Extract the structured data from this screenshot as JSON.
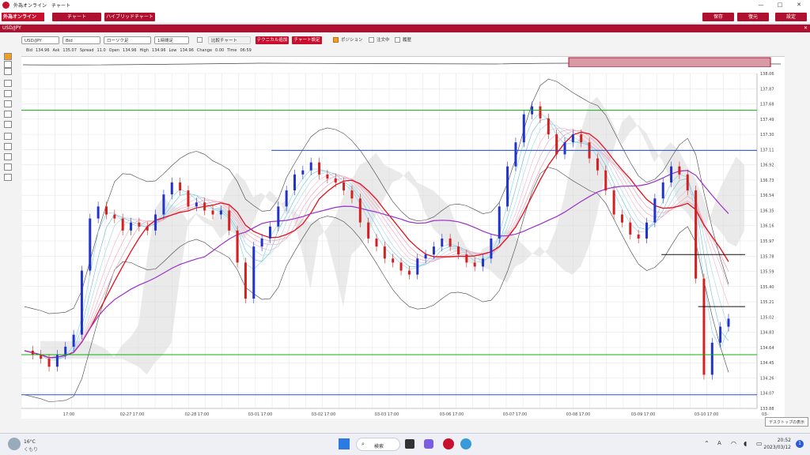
{
  "app": {
    "title": "外為オンライン　チャート"
  },
  "nav": {
    "brand": "外為オンライン",
    "chart": "チャート",
    "hybrid": "ハイブリッドチャート",
    "save": "保存",
    "restore": "復元",
    "settings": "設定"
  },
  "pair": "USD/JPY",
  "toolbar": {
    "symbol": "USD/JPY",
    "price_type": "Bid",
    "chart_type": "ローソク足",
    "timeframe": "1時間足",
    "compare": "比較チャート",
    "add_tech": "テクニカル追加",
    "chart_settings": "チャート設定",
    "position": "ポジション",
    "order": "注文中",
    "history": "履歴"
  },
  "info": [
    "Bid",
    "134.96",
    "Ask",
    "135.07",
    "Spread",
    "11.0",
    "Open",
    "134.96",
    "High",
    "134.96",
    "Low",
    "134.96",
    "Change",
    "0.00",
    "Time",
    "06:59"
  ],
  "taskbar": {
    "temp": "16°C",
    "weather": "くもり",
    "search": "検索",
    "time": "20:52",
    "date": "2023/03/12",
    "tooltip": "デスクトップの表示",
    "ime": "A",
    "notif": "1"
  },
  "colors": {
    "brand": "#c8102e",
    "bull": "#2233cc",
    "bear": "#d42020",
    "ma_red": "#e0101a",
    "ma_purple": "#9b30c8",
    "green": "#10b010",
    "blue": "#2050d0"
  },
  "chart_data": {
    "type": "candlestick",
    "yticks": [
      "138.06",
      "137.87",
      "137.68",
      "137.49",
      "137.30",
      "137.11",
      "136.92",
      "136.73",
      "136.54",
      "136.35",
      "136.16",
      "135.97",
      "135.78",
      "135.59",
      "135.40",
      "135.21",
      "135.02",
      "134.83",
      "134.64",
      "134.45",
      "134.26",
      "134.07",
      "133.88"
    ],
    "xticks": [
      "17:00",
      "02-27 17:00",
      "02-28 17:00",
      "03-01 17:00",
      "03-02 17:00",
      "03-03 17:00",
      "03-06 17:00",
      "03-07 17:00",
      "03-08 17:00",
      "03-09 17:00",
      "03-10 17:00",
      "03-"
    ],
    "ylim": [
      133.88,
      138.06
    ],
    "hlines": [
      {
        "value": 137.6,
        "color": "green"
      },
      {
        "value": 137.1,
        "color": "blue",
        "from_frac": 0.34
      },
      {
        "value": 135.22,
        "color": "red"
      },
      {
        "value": 134.55,
        "color": "green"
      },
      {
        "value": 134.05,
        "color": "blue"
      },
      {
        "value": 135.8,
        "color": "black",
        "from_frac": 0.87
      },
      {
        "value": 135.15,
        "color": "black",
        "from_frac": 0.92
      }
    ],
    "close_path": [
      134.6,
      134.55,
      134.5,
      134.4,
      134.55,
      134.65,
      134.8,
      135.6,
      136.25,
      136.4,
      136.3,
      136.25,
      136.1,
      136.2,
      136.15,
      136.1,
      136.3,
      136.55,
      136.7,
      136.6,
      136.4,
      136.45,
      136.35,
      136.3,
      136.35,
      136.1,
      135.7,
      135.25,
      135.9,
      136.0,
      136.15,
      136.4,
      136.6,
      136.8,
      136.85,
      136.95,
      136.8,
      136.75,
      136.7,
      136.6,
      136.5,
      136.2,
      136.0,
      135.9,
      135.75,
      135.7,
      135.6,
      135.55,
      135.75,
      135.8,
      135.9,
      136.0,
      135.9,
      135.8,
      135.7,
      135.65,
      135.75,
      136.0,
      136.4,
      136.9,
      137.2,
      137.55,
      137.65,
      137.5,
      137.3,
      137.05,
      137.2,
      137.3,
      137.2,
      137.0,
      136.85,
      136.6,
      136.3,
      136.2,
      136.05,
      136.0,
      136.2,
      136.5,
      136.7,
      136.9,
      136.8,
      136.6,
      135.5,
      134.3,
      134.7,
      134.9,
      135.0
    ]
  }
}
